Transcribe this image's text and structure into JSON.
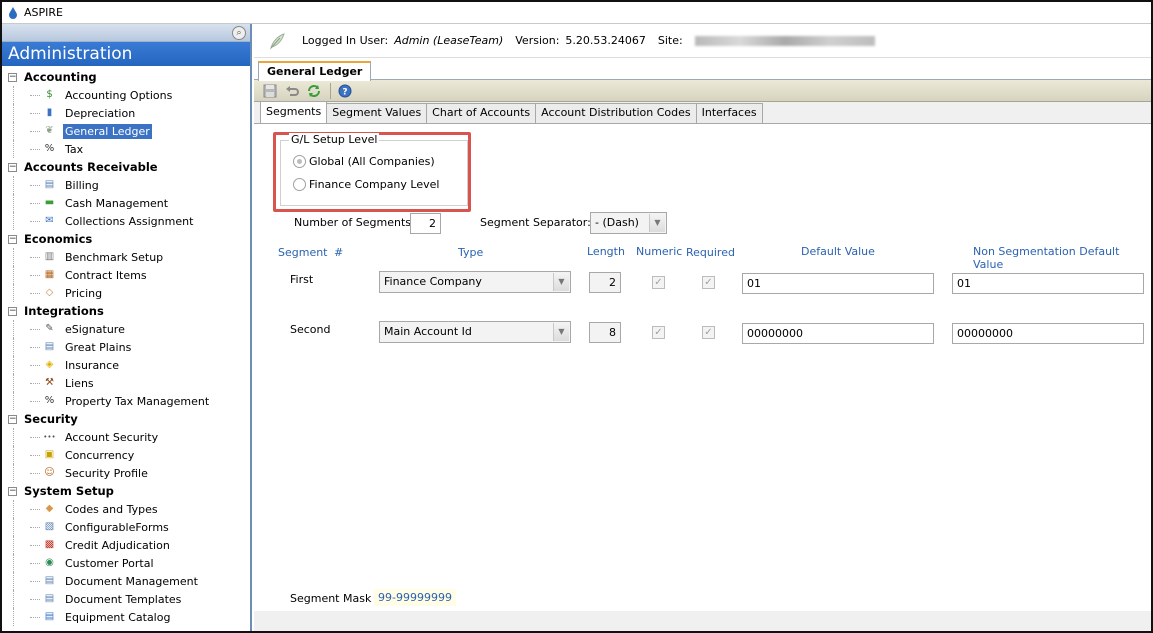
{
  "window": {
    "title": "ASPIRE"
  },
  "sidebar": {
    "header": "Administration",
    "categories": [
      {
        "label": "Accounting",
        "items": [
          {
            "label": "Accounting Options",
            "icon": "dollar-icon"
          },
          {
            "label": "Depreciation",
            "icon": "bar-chart-icon"
          },
          {
            "label": "General Ledger",
            "icon": "feather-icon",
            "selected": true
          },
          {
            "label": "Tax",
            "icon": "percent-icon"
          }
        ]
      },
      {
        "label": "Accounts Receivable",
        "items": [
          {
            "label": "Billing",
            "icon": "document-icon"
          },
          {
            "label": "Cash Management",
            "icon": "cash-icon"
          },
          {
            "label": "Collections Assignment",
            "icon": "chat-icon"
          }
        ]
      },
      {
        "label": "Economics",
        "items": [
          {
            "label": "Benchmark Setup",
            "icon": "benchmark-icon"
          },
          {
            "label": "Contract Items",
            "icon": "grid-icon"
          },
          {
            "label": "Pricing",
            "icon": "price-tag-icon"
          }
        ]
      },
      {
        "label": "Integrations",
        "items": [
          {
            "label": "eSignature",
            "icon": "signature-icon"
          },
          {
            "label": "Great Plains",
            "icon": "document-icon"
          },
          {
            "label": "Insurance",
            "icon": "shield-icon"
          },
          {
            "label": "Liens",
            "icon": "gavel-icon"
          },
          {
            "label": "Property Tax Management",
            "icon": "percent-icon"
          }
        ]
      },
      {
        "label": "Security",
        "items": [
          {
            "label": "Account Security",
            "icon": "password-icon"
          },
          {
            "label": "Concurrency",
            "icon": "lock-icon"
          },
          {
            "label": "Security Profile",
            "icon": "user-icon"
          }
        ]
      },
      {
        "label": "System Setup",
        "items": [
          {
            "label": "Codes and Types",
            "icon": "tag-icon"
          },
          {
            "label": "ConfigurableForms",
            "icon": "form-icon"
          },
          {
            "label": "Credit  Adjudication",
            "icon": "calculator-icon"
          },
          {
            "label": "Customer Portal",
            "icon": "globe-icon"
          },
          {
            "label": "Document Management",
            "icon": "document-icon"
          },
          {
            "label": "Document Templates",
            "icon": "document-icon"
          },
          {
            "label": "Equipment Catalog",
            "icon": "book-icon"
          }
        ]
      }
    ]
  },
  "infobar": {
    "logged_in_label": "Logged In User:",
    "logged_in_value": "Admin  (LeaseTeam)",
    "version_label": "Version:",
    "version_value": "5.20.53.24067",
    "site_label": "Site:"
  },
  "document_tab": "General Ledger",
  "toolbar": {
    "icons": [
      "save-icon",
      "undo-icon",
      "refresh-icon",
      "help-icon"
    ]
  },
  "tabs": [
    "Segments",
    "Segment Values",
    "Chart of Accounts",
    "Account Distribution Codes",
    "Interfaces"
  ],
  "gl_setup": {
    "legend": "G/L Setup Level",
    "options": [
      {
        "label": "Global (All Companies)",
        "selected": true
      },
      {
        "label": "Finance Company Level",
        "selected": false
      }
    ]
  },
  "segments_count": {
    "label": "Number of Segments:",
    "value": "2"
  },
  "separator": {
    "label": "Segment Separator:",
    "value": "- (Dash)"
  },
  "columns": {
    "segment": "Segment",
    "number": "#",
    "type": "Type",
    "length": "Length",
    "numeric": "Numeric",
    "required": "Required",
    "default": "Default Value",
    "non_seg_default": "Non Segmentation Default Value"
  },
  "rows": [
    {
      "name": "First",
      "type": "Finance Company",
      "length": "2",
      "numeric": true,
      "required": true,
      "default": "01",
      "non_seg_default": "01"
    },
    {
      "name": "Second",
      "type": "Main Account Id",
      "length": "8",
      "numeric": true,
      "required": true,
      "default": "00000000",
      "non_seg_default": "00000000"
    }
  ],
  "mask": {
    "label": "Segment Mask",
    "value": "99-99999999"
  },
  "colors": {
    "header_blue": "#2465c0",
    "selection_blue": "#3b72c4",
    "highlight_red": "#d9534f",
    "column_header": "#2b62b0"
  }
}
